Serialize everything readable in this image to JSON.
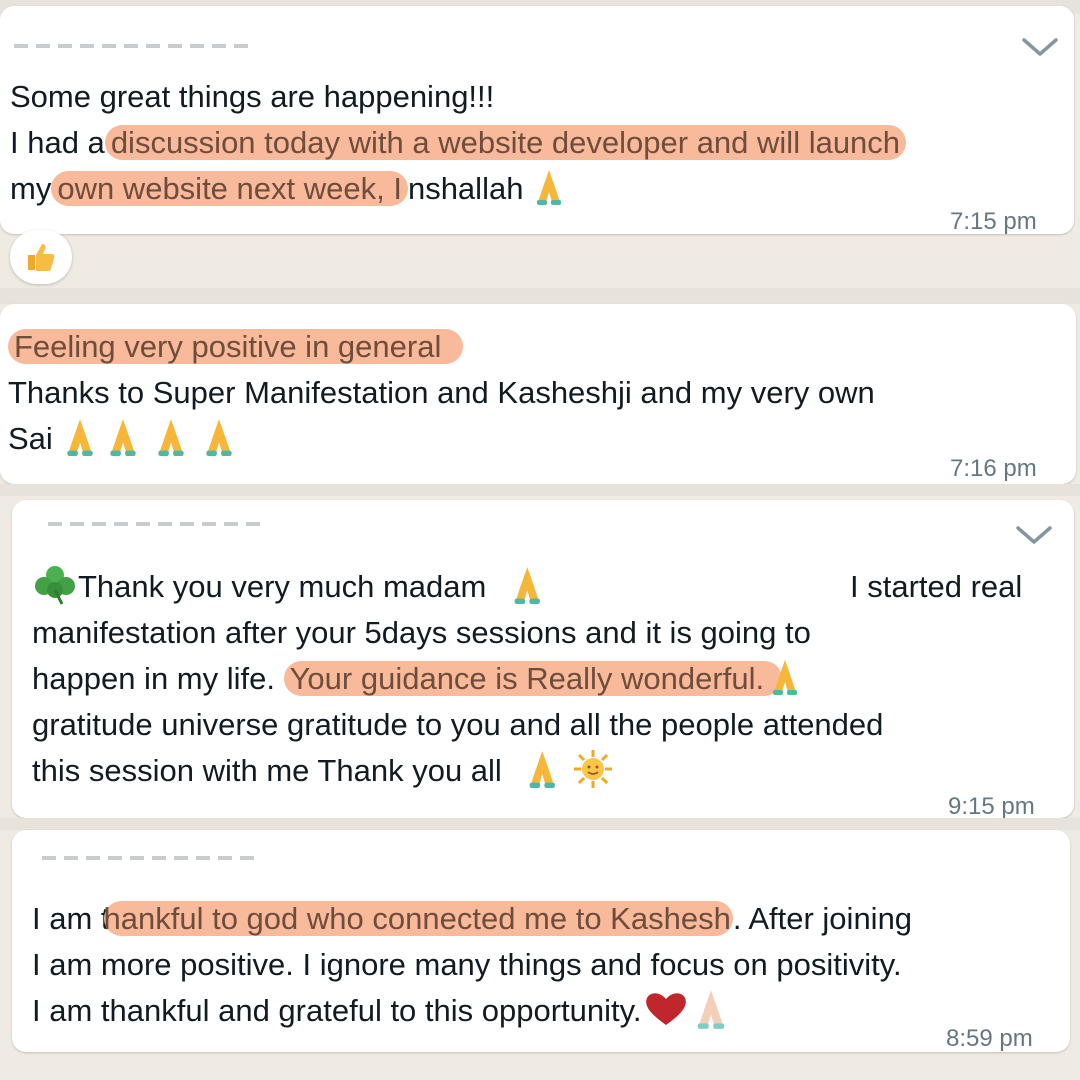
{
  "messages": [
    {
      "lines": [
        {
          "parts": [
            {
              "text": "Some great things are happening!!!",
              "hl": false
            }
          ]
        },
        {
          "parts": [
            {
              "text": "I had a",
              "hl": false
            },
            {
              "text": "discussion today with a website developer and will launch",
              "hl": true
            }
          ]
        },
        {
          "parts": [
            {
              "text": "my",
              "hl": false
            },
            {
              "text": "own website next week, I",
              "hl": true
            },
            {
              "text": "nshallah",
              "hl": false
            }
          ],
          "emoji": [
            "pray"
          ]
        }
      ],
      "time": "7:15 pm",
      "reaction": "thumbs-up"
    },
    {
      "lines": [
        {
          "parts": [
            {
              "text": "Feeling very positive in general",
              "hl": true
            }
          ]
        },
        {
          "parts": [
            {
              "text": "Thanks to Super Manifestation and Kasheshji and my very own",
              "hl": false
            }
          ]
        },
        {
          "parts": [
            {
              "text": "Sai",
              "hl": false
            }
          ],
          "emoji": [
            "pray",
            "pray",
            "pray",
            "pray"
          ]
        }
      ],
      "time": "7:16 pm"
    },
    {
      "lines": [
        {
          "parts": [
            {
              "text": "Thank you very much madam",
              "hl": false
            }
          ],
          "prefix_emoji": "shamrock",
          "emoji": [
            "pray"
          ],
          "trail": "I started real"
        },
        {
          "parts": [
            {
              "text": "manifestation after your 5days sessions and it is going to",
              "hl": false
            }
          ]
        },
        {
          "parts": [
            {
              "text": "happen in my life. ",
              "hl": false
            },
            {
              "text": "Your guidance is  Really wonderful.",
              "hl": true
            }
          ],
          "emoji": [
            "pray"
          ]
        },
        {
          "parts": [
            {
              "text": "gratitude universe gratitude to you and all the people attended",
              "hl": false
            }
          ]
        },
        {
          "parts": [
            {
              "text": "this session with me Thank you all",
              "hl": false
            }
          ],
          "emoji": [
            "pray",
            "sun"
          ]
        }
      ],
      "time": "9:15 pm"
    },
    {
      "lines": [
        {
          "parts": [
            {
              "text": "I am t",
              "hl": false
            },
            {
              "text": "hankful to god who connected me to Kashesh",
              "hl": true
            },
            {
              "text": ". After joining",
              "hl": false
            }
          ]
        },
        {
          "parts": [
            {
              "text": "I am more positive. I ignore many things and focus on positivity.",
              "hl": false
            }
          ]
        },
        {
          "parts": [
            {
              "text": "I am thankful and grateful to this opportunity.",
              "hl": false
            }
          ],
          "emoji": [
            "heart",
            "pray-light"
          ]
        }
      ],
      "time": "8:59 pm"
    }
  ],
  "colors": {
    "highlight": "#f9b99b",
    "bubble": "#ffffff",
    "background": "#efeae2",
    "timestamp": "#667781"
  }
}
